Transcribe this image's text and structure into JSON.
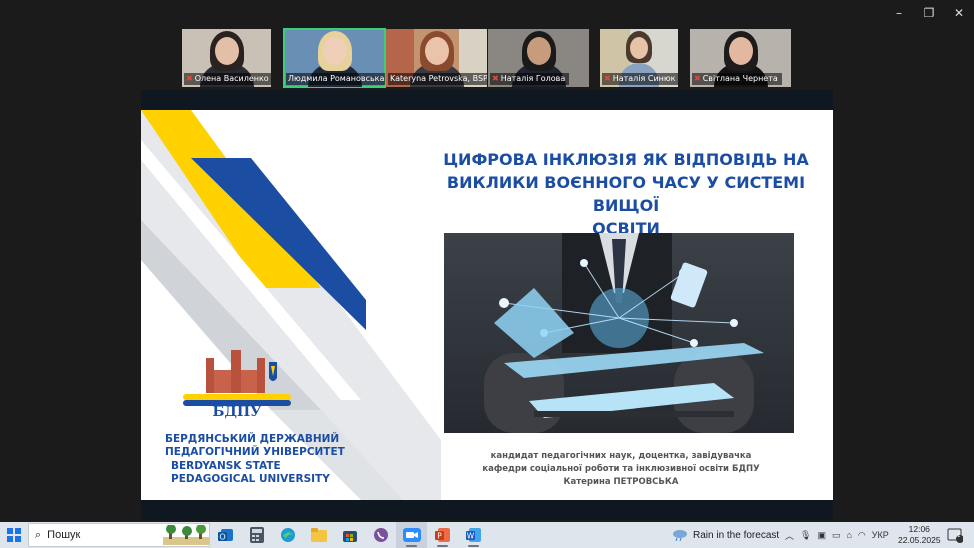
{
  "window": {
    "controls": {
      "minimize": "–",
      "restore": "❐",
      "close": "✕"
    }
  },
  "participants": [
    {
      "name": "Олена Василенко",
      "muted": true
    },
    {
      "name": "Людмила Романовська",
      "muted": false,
      "active": true
    },
    {
      "name": "Kateryna Petrovska, BSPU",
      "muted": false
    },
    {
      "name": "Наталія Голова",
      "muted": true
    },
    {
      "name": "Наталія Синюк",
      "muted": true
    },
    {
      "name": "Світлана Чернета",
      "muted": true
    }
  ],
  "slide": {
    "title_line1": "ЦИФРОВА ІНКЛЮЗІЯ ЯК ВІДПОВІДЬ НА",
    "title_line2": "ВИКЛИКИ ВОЄННОГО ЧАСУ У СИСТЕМІ ВИЩОЇ",
    "title_line3": "ОСВІТИ",
    "logo_text": "БДПУ",
    "university_ua_line1": "БЕРДЯНСЬКИЙ ДЕРЖАВНИЙ",
    "university_ua_line2": "ПЕДАГОГІЧНИЙ УНІВЕРСИТЕТ",
    "university_en_line1": "BERDYANSK STATE",
    "university_en_line2": "PEDAGOGICAL UNIVERSITY",
    "caption_line1": "кандидат педагогічних наук, доцентка, завідувачка",
    "caption_line2": "кафедри соціальної роботи та інклюзивної освіти БДПУ",
    "caption_line3": "Катерина ПЕТРОВСЬКА",
    "colors": {
      "blue": "#1b4ea3",
      "yellow": "#ffd100"
    }
  },
  "taskbar": {
    "search_label": "Пошук",
    "weather_text": "Rain in the forecast",
    "language": "УКР",
    "time": "12:06",
    "date": "22.05.2025",
    "notification_count": "1",
    "apps": [
      "outlook-icon",
      "calculator-icon",
      "edge-icon",
      "file-explorer-icon",
      "store-icon",
      "viber-icon",
      "zoom-icon",
      "powerpoint-icon",
      "word-icon"
    ]
  }
}
